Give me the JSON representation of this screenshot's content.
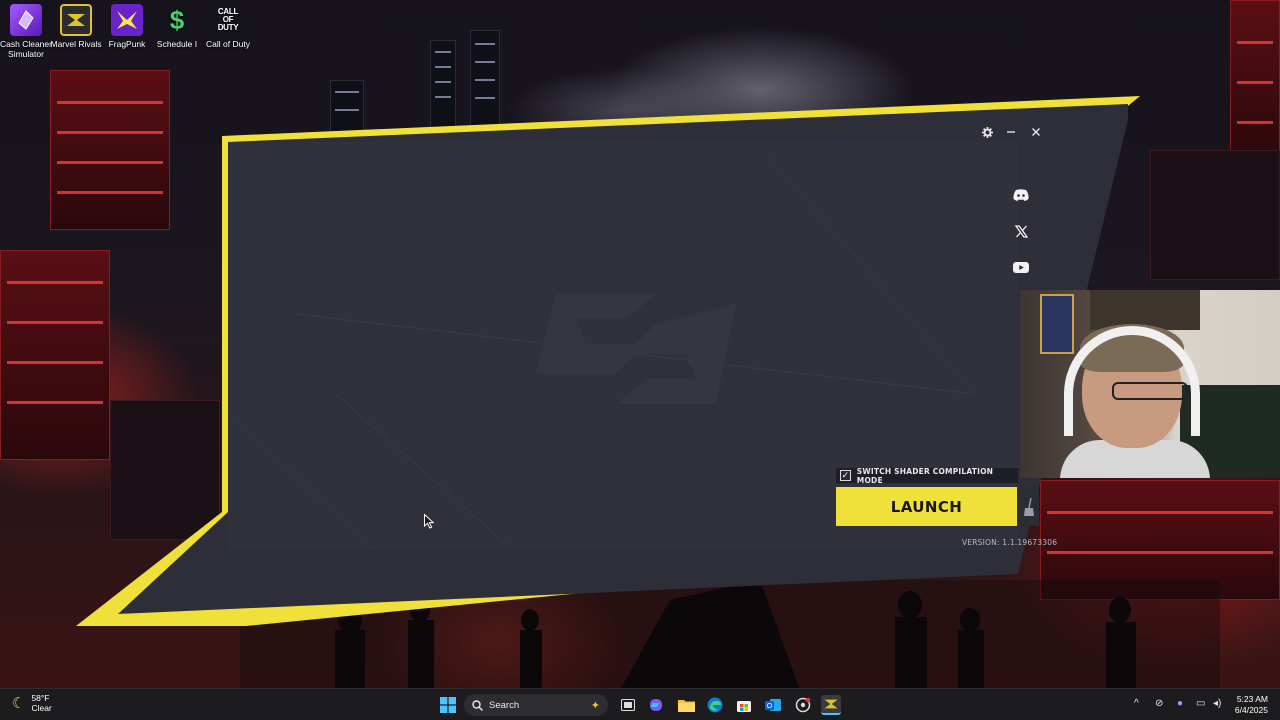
{
  "desktop": {
    "icons": [
      {
        "label": "Cash Cleaner Simulator",
        "color": "#7a2fd6",
        "icon": "crystal-icon"
      },
      {
        "label": "Marvel Rivals",
        "color": "#e0c22a",
        "icon": "marvel-rivals-icon"
      },
      {
        "label": "FragPunk",
        "color": "#6a22c9",
        "icon": "fragpunk-icon"
      },
      {
        "label": "Schedule I",
        "color": "#2a9a45",
        "icon": "dollar-icon"
      },
      {
        "label": "Call of Duty",
        "color": "#111111",
        "icon": "call-of-duty-icon"
      }
    ],
    "cod_logo": "CALL OF DUTY"
  },
  "launcher": {
    "accent": "#f0e13a",
    "window_controls": [
      "settings",
      "minimize",
      "close"
    ],
    "social": [
      "discord-icon",
      "x-twitter-icon",
      "youtube-icon"
    ],
    "shader_label": "SWITCH SHADER COMPILATION MODE",
    "shader_checked": true,
    "shader_check_glyph": "✓",
    "launch_label": "LAUNCH",
    "version": "VERSION: 1.1.19673306"
  },
  "taskbar": {
    "weather_temp": "58°F",
    "weather_cond": "Clear",
    "search_label": "Search",
    "time": "5:23 AM",
    "date": "6/4/2025"
  }
}
